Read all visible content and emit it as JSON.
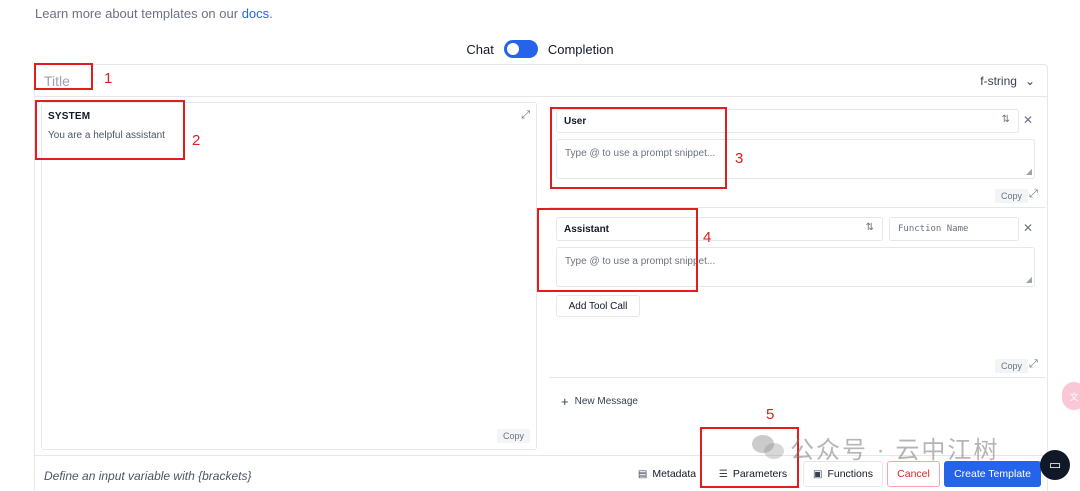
{
  "top_note": {
    "text": "Learn more about templates on our ",
    "link": "docs",
    "suffix": "."
  },
  "mode_toggle": {
    "left": "Chat",
    "right": "Completion"
  },
  "title_field": {
    "placeholder": "Title"
  },
  "format_select": {
    "value": "f-string"
  },
  "system": {
    "title": "SYSTEM",
    "text": "You are a helpful assistant",
    "copy_label": "Copy"
  },
  "messages": [
    {
      "role": "User",
      "placeholder": "Type @ to use a prompt snippet...",
      "copy_label": "Copy"
    },
    {
      "role": "Assistant",
      "placeholder": "Type @ to use a prompt snippet...",
      "function_name_placeholder": "Function Name",
      "tool_call_label": "Add Tool Call",
      "copy_label": "Copy"
    }
  ],
  "new_message_label": "New Message",
  "footer": {
    "hint": "Define an input variable with {brackets}",
    "metadata_label": "Metadata",
    "parameters_label": "Parameters",
    "functions_label": "Functions",
    "cancel_label": "Cancel",
    "create_label": "Create Template"
  },
  "annotations": [
    "1",
    "2",
    "3",
    "4",
    "5"
  ],
  "watermark": {
    "text": "公众号 · 云中江树"
  },
  "colors": {
    "accent": "#2563eb",
    "annotation": "#e11d1d",
    "cancel": "#dc2626"
  }
}
